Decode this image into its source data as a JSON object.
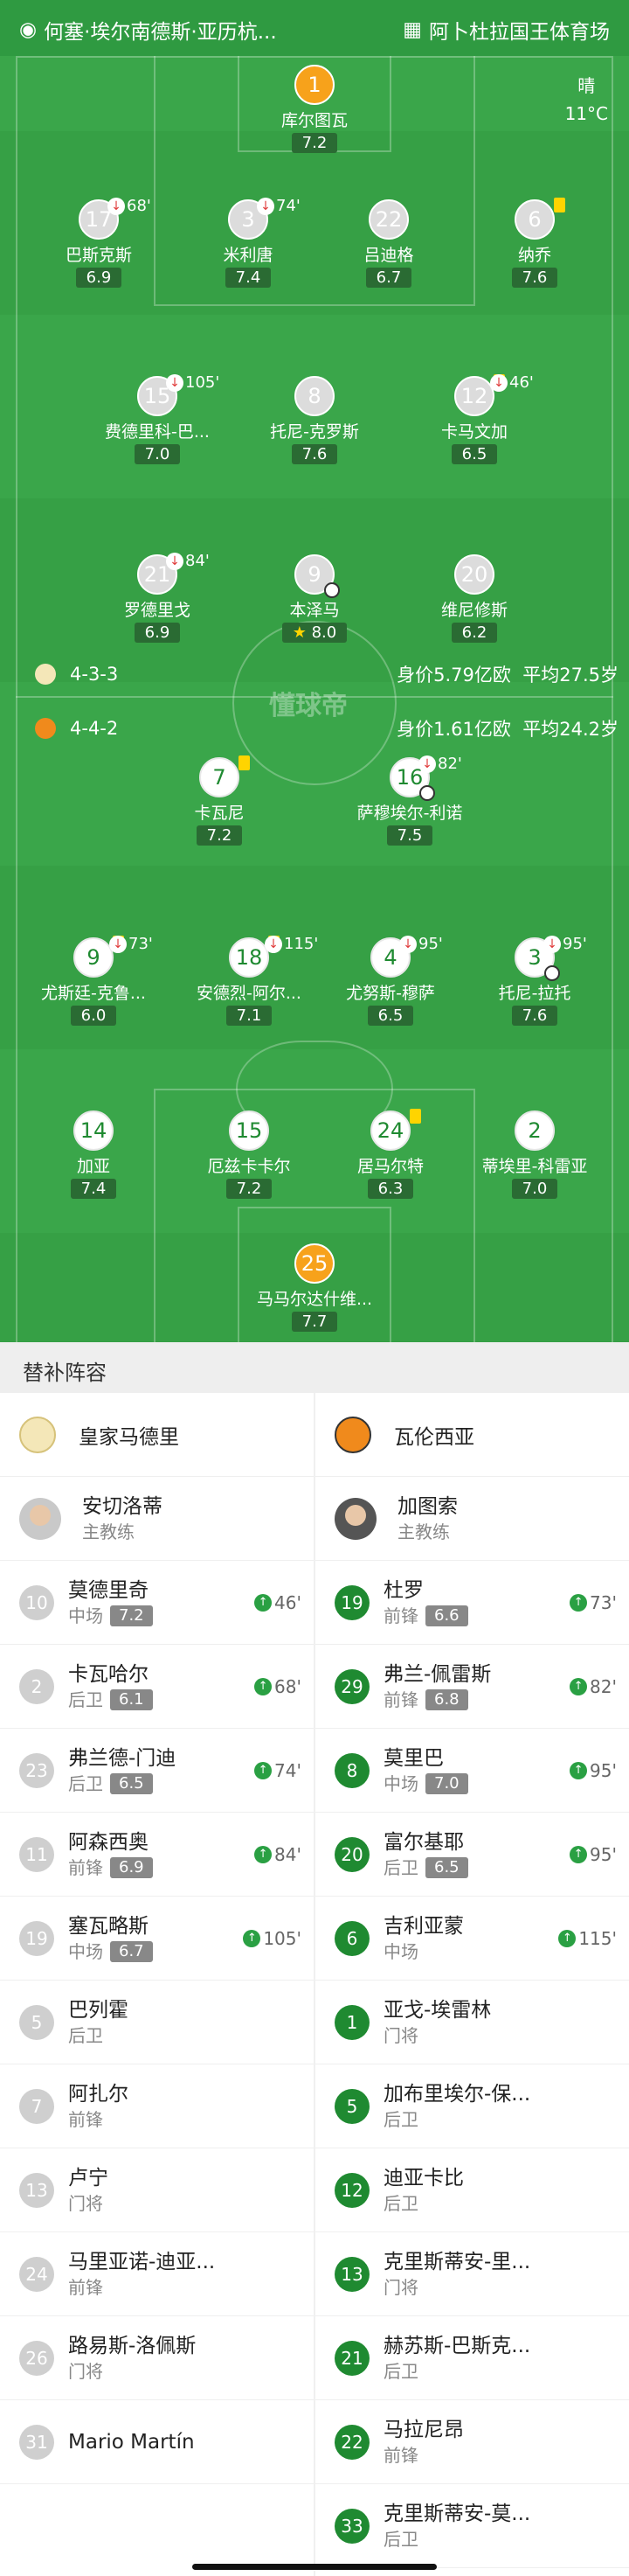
{
  "header": {
    "left_text": "何塞·埃尔南德斯·亚历杭...",
    "right_text": "阿卜杜拉国王体育场"
  },
  "weather": {
    "condition": "晴",
    "temperature": "11°C"
  },
  "watermark": "懂球帝",
  "home_team": {
    "formation": "4-3-3",
    "value": "身价5.79亿欧",
    "avg_age": "平均27.5岁"
  },
  "away_team": {
    "formation": "4-4-2",
    "value": "身价1.61亿欧",
    "avg_age": "平均24.2岁"
  },
  "pitch_home": [
    {
      "num": "1",
      "name": "库尔图瓦",
      "rating": "7.2",
      "gk": true
    },
    {
      "num": "17",
      "name": "巴斯克斯",
      "rating": "6.9",
      "sub": "68'"
    },
    {
      "num": "3",
      "name": "米利唐",
      "rating": "7.4",
      "sub": "74'"
    },
    {
      "num": "22",
      "name": "吕迪格",
      "rating": "6.7"
    },
    {
      "num": "6",
      "name": "纳乔",
      "rating": "7.6",
      "yellow": true
    },
    {
      "num": "15",
      "name": "费德里科-巴...",
      "rating": "7.0",
      "sub": "105'"
    },
    {
      "num": "8",
      "name": "托尼-克罗斯",
      "rating": "7.6"
    },
    {
      "num": "12",
      "name": "卡马文加",
      "rating": "6.5",
      "sub": "46'",
      "yellow": true
    },
    {
      "num": "21",
      "name": "罗德里戈",
      "rating": "6.9",
      "sub": "84'"
    },
    {
      "num": "9",
      "name": "本泽马",
      "rating": "8.0",
      "star": true,
      "goal": true
    },
    {
      "num": "20",
      "name": "维尼修斯",
      "rating": "6.2"
    }
  ],
  "pitch_away": [
    {
      "num": "7",
      "name": "卡瓦尼",
      "rating": "7.2",
      "yellow": true
    },
    {
      "num": "16",
      "name": "萨穆埃尔-利诺",
      "rating": "7.5",
      "sub": "82'",
      "goal": true
    },
    {
      "num": "9",
      "name": "尤斯廷-克鲁...",
      "rating": "6.0",
      "sub": "73'",
      "yellow": true
    },
    {
      "num": "18",
      "name": "安德烈-阿尔...",
      "rating": "7.1",
      "sub": "115'",
      "yellow": true
    },
    {
      "num": "4",
      "name": "尤努斯-穆萨",
      "rating": "6.5",
      "sub": "95'"
    },
    {
      "num": "3",
      "name": "托尼-拉托",
      "rating": "7.6",
      "sub": "95'",
      "goal": true
    },
    {
      "num": "14",
      "name": "加亚",
      "rating": "7.4"
    },
    {
      "num": "15",
      "name": "厄兹卡卡尔",
      "rating": "7.2"
    },
    {
      "num": "24",
      "name": "居马尔特",
      "rating": "6.3",
      "yellow": true
    },
    {
      "num": "2",
      "name": "蒂埃里-科雷亚",
      "rating": "7.0"
    },
    {
      "num": "25",
      "name": "马马尔达什维...",
      "rating": "7.7",
      "gk": true
    }
  ],
  "subs_title": "替补阵容",
  "subs_home": {
    "team": "皇家马德里",
    "coach": "安切洛蒂",
    "coach_role": "主教练",
    "players": [
      {
        "num": "10",
        "name": "莫德里奇",
        "pos": "中场",
        "rating": "7.2",
        "in": "46'"
      },
      {
        "num": "2",
        "name": "卡瓦哈尔",
        "pos": "后卫",
        "rating": "6.1",
        "in": "68'"
      },
      {
        "num": "23",
        "name": "弗兰德-门迪",
        "pos": "后卫",
        "rating": "6.5",
        "in": "74'"
      },
      {
        "num": "11",
        "name": "阿森西奥",
        "pos": "前锋",
        "rating": "6.9",
        "in": "84'"
      },
      {
        "num": "19",
        "name": "塞瓦略斯",
        "pos": "中场",
        "rating": "6.7",
        "in": "105'"
      },
      {
        "num": "5",
        "name": "巴列霍",
        "pos": "后卫"
      },
      {
        "num": "7",
        "name": "阿扎尔",
        "pos": "前锋"
      },
      {
        "num": "13",
        "name": "卢宁",
        "pos": "门将"
      },
      {
        "num": "24",
        "name": "马里亚诺-迪亚...",
        "pos": "前锋"
      },
      {
        "num": "26",
        "name": "路易斯-洛佩斯",
        "pos": "门将"
      },
      {
        "num": "31",
        "name": "Mario Martín",
        "pos": ""
      }
    ]
  },
  "subs_away": {
    "team": "瓦伦西亚",
    "coach": "加图索",
    "coach_role": "主教练",
    "players": [
      {
        "num": "19",
        "name": "杜罗",
        "pos": "前锋",
        "rating": "6.6",
        "in": "73'"
      },
      {
        "num": "29",
        "name": "弗兰-佩雷斯",
        "pos": "前锋",
        "rating": "6.8",
        "in": "82'"
      },
      {
        "num": "8",
        "name": "莫里巴",
        "pos": "中场",
        "rating": "7.0",
        "in": "95'"
      },
      {
        "num": "20",
        "name": "富尔基耶",
        "pos": "后卫",
        "rating": "6.5",
        "in": "95'"
      },
      {
        "num": "6",
        "name": "吉利亚蒙",
        "pos": "中场",
        "in": "115'"
      },
      {
        "num": "1",
        "name": "亚戈-埃雷林",
        "pos": "门将"
      },
      {
        "num": "5",
        "name": "加布里埃尔-保...",
        "pos": "后卫"
      },
      {
        "num": "12",
        "name": "迪亚卡比",
        "pos": "后卫"
      },
      {
        "num": "13",
        "name": "克里斯蒂安-里...",
        "pos": "门将"
      },
      {
        "num": "21",
        "name": "赫苏斯-巴斯克...",
        "pos": "后卫"
      },
      {
        "num": "22",
        "name": "马拉尼昂",
        "pos": "前锋"
      },
      {
        "num": "33",
        "name": "克里斯蒂安-莫...",
        "pos": "后卫"
      }
    ]
  },
  "colors": {
    "pitch": "#3aa64a",
    "rating_bg": "#2a6b33",
    "yellow_card": "#ffd400",
    "sub_out": "#e03c3c",
    "sub_in": "#2aa043"
  }
}
